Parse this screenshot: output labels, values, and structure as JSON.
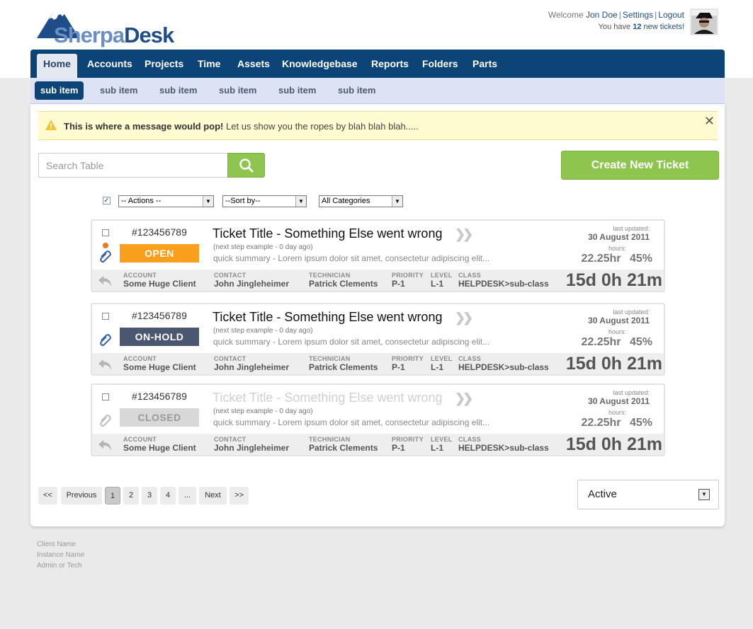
{
  "header": {
    "logo_text_1": "Sherpa",
    "logo_text_2": "Desk",
    "welcome_label": "Welcome",
    "user_name": "Jon Doe",
    "settings_link": "Settings",
    "logout_link": "Logout",
    "tickets_prefix": "You have",
    "tickets_count": "12",
    "tickets_suffix": "new tickets!"
  },
  "nav": {
    "tabs": [
      {
        "label": "Home",
        "active": true
      },
      {
        "label": "Accounts"
      },
      {
        "label": "Projects"
      },
      {
        "label": "Time"
      },
      {
        "label": "Assets"
      },
      {
        "label": "Knowledgebase"
      },
      {
        "label": "Reports"
      },
      {
        "label": "Folders"
      },
      {
        "label": "Parts"
      }
    ],
    "subtabs": [
      {
        "label": "sub item",
        "active": true
      },
      {
        "label": "sub item"
      },
      {
        "label": "sub item"
      },
      {
        "label": "sub item"
      },
      {
        "label": "sub item"
      },
      {
        "label": "sub item"
      }
    ]
  },
  "message": {
    "bold": "This is where a message would pop!",
    "text": "Let us show you the ropes by blah blah blah.....",
    "close": "✕"
  },
  "search": {
    "placeholder": "Search Table"
  },
  "create_button": "Create New Ticket",
  "filters": {
    "actions": "-- Actions --",
    "sort": "--Sort by--",
    "categories": "All Categories"
  },
  "colors": {
    "nav_bg": "#0c4477",
    "open": "#f99f1b",
    "on_hold": "#4b5770",
    "closed": "#d8d8d8",
    "green": "#8ec54f"
  },
  "tickets": [
    {
      "number": "#123456789",
      "status": "OPEN",
      "title": "Ticket Title - Something Else went wrong",
      "next_step": "(next step example - 0 day ago)",
      "summary": "quick summary - Lorem ipsum dolor sit amet, consectetur adipiscing elit...",
      "last_updated_label": "last updated:",
      "last_updated": "30 August 2011",
      "hours_label": "hours:",
      "hours": "22.25hr",
      "percent": "45%",
      "account_label": "ACCOUNT",
      "account": "Some Huge Client",
      "contact_label": "CONTACT",
      "contact": "John Jingleheimer",
      "technician_label": "TECHNICIAN",
      "technician": "Patrick Clements",
      "priority_label": "PRIORITY",
      "priority": "P-1",
      "level_label": "LEVEL",
      "level": "L-1",
      "class_label": "CLASS",
      "class": "HELPDESK>sub-class",
      "elapsed": "15d 0h 21m"
    },
    {
      "number": "#123456789",
      "status": "ON-HOLD",
      "title": "Ticket Title - Something Else went wrong",
      "next_step": "(next step example - 0 day ago)",
      "summary": "quick summary - Lorem ipsum dolor sit amet, consectetur adipiscing elit...",
      "last_updated_label": "last updated:",
      "last_updated": "30 August 2011",
      "hours_label": "hours:",
      "hours": "22.25hr",
      "percent": "45%",
      "account_label": "ACCOUNT",
      "account": "Some Huge Client",
      "contact_label": "CONTACT",
      "contact": "John Jingleheimer",
      "technician_label": "TECHNICIAN",
      "technician": "Patrick Clements",
      "priority_label": "PRIORITY",
      "priority": "P-1",
      "level_label": "LEVEL",
      "level": "L-1",
      "class_label": "CLASS",
      "class": "HELPDESK>sub-class",
      "elapsed": "15d 0h 21m"
    },
    {
      "number": "#123456789",
      "status": "CLOSED",
      "title": "Ticket Title - Something Else went wrong",
      "next_step": "(next step example - 0 day ago)",
      "summary": "quick summary - Lorem ipsum dolor sit amet, consectetur adipiscing elit...",
      "last_updated_label": "last updated:",
      "last_updated": "30 August 2011",
      "hours_label": "hours:",
      "hours": "22.25hr",
      "percent": "45%",
      "account_label": "ACCOUNT",
      "account": "Some Huge Client",
      "contact_label": "CONTACT",
      "contact": "John Jingleheimer",
      "technician_label": "TECHNICIAN",
      "technician": "Patrick Clements",
      "priority_label": "PRIORITY",
      "priority": "P-1",
      "level_label": "LEVEL",
      "level": "L-1",
      "class_label": "CLASS",
      "class": "HELPDESK>sub-class",
      "elapsed": "15d 0h 21m"
    }
  ],
  "pagination": {
    "first": "<<",
    "previous": "Previous",
    "pages": [
      "1",
      "2",
      "3",
      "4",
      "..."
    ],
    "next": "Next",
    "last": ">>"
  },
  "status_filter": "Active",
  "footer": {
    "client": "Client Name",
    "instance": "Instance Name",
    "role": "Admin or Tech"
  }
}
